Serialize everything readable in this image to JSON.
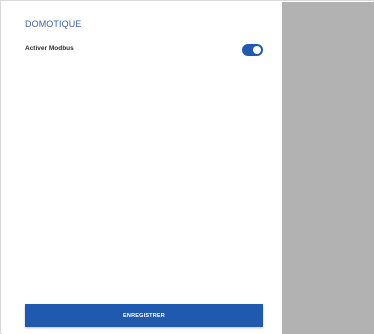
{
  "panel": {
    "section_title": "DOMOTIQUE",
    "settings": [
      {
        "label": "Activer Modbus",
        "enabled": true
      }
    ],
    "save_label": "ENREGISTRER"
  },
  "colors": {
    "accent": "#1f5ab0",
    "title": "#3c63a8",
    "side_area": "#b2b2b2"
  }
}
